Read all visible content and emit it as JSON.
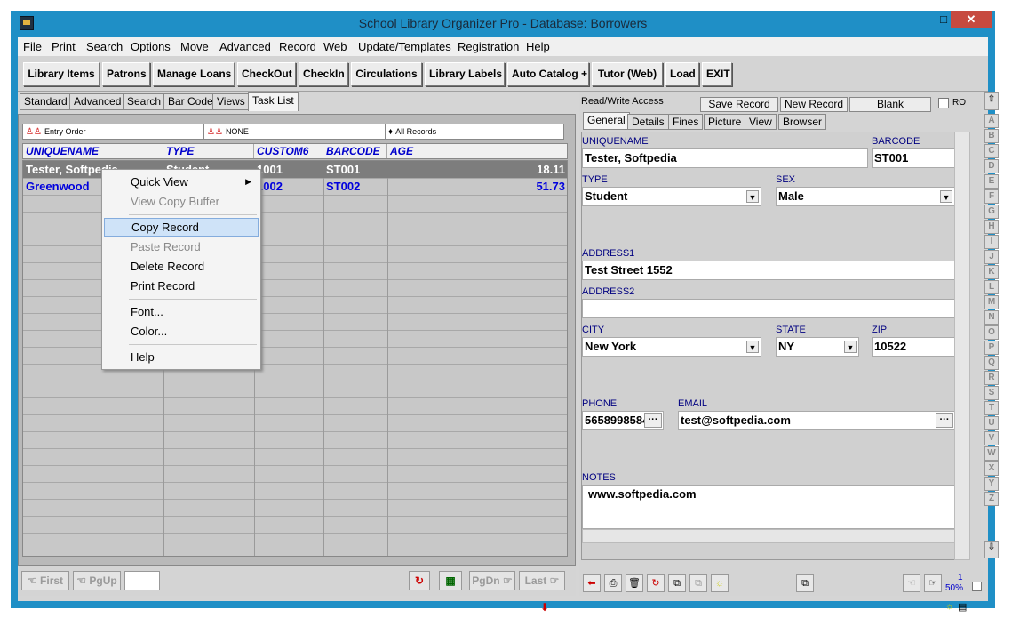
{
  "window": {
    "title": "School Library Organizer Pro - Database: Borrowers"
  },
  "menu": [
    "File",
    "Print",
    "Search",
    "Options",
    "Move",
    "Advanced",
    "Record",
    "Web",
    "Update/Templates",
    "Registration",
    "Help"
  ],
  "toolbar": [
    "Library Items",
    "Patrons",
    "Manage Loans",
    "CheckOut",
    "CheckIn",
    "Circulations",
    "Library Labels",
    "Auto Catalog +",
    "Tutor (Web)",
    "Load",
    "EXIT"
  ],
  "left_tabs": [
    "Standard",
    "Advanced",
    "Search",
    "Bar Code",
    "Views",
    "Task List"
  ],
  "sort_bar": [
    "Entry Order",
    "NONE",
    "All Records"
  ],
  "columns": [
    "UNIQUENAME",
    "TYPE",
    "CUSTOM6",
    "BARCODE",
    "AGE"
  ],
  "rows": [
    {
      "uniquename": "Tester, Softpedia",
      "type": "Student",
      "custom6": "1001",
      "barcode": "ST001",
      "age": "18.11"
    },
    {
      "uniquename": "Greenwood",
      "type": "",
      "custom6": "1002",
      "barcode": "ST002",
      "age": "51.73"
    }
  ],
  "context_menu": {
    "items": [
      {
        "label": "Quick View",
        "disabled": false,
        "submenu": true
      },
      {
        "label": "View Copy Buffer",
        "disabled": true
      },
      {
        "label": "Copy Record",
        "disabled": false,
        "highlighted": true
      },
      {
        "label": "Paste Record",
        "disabled": true
      },
      {
        "label": "Delete Record",
        "disabled": false
      },
      {
        "label": "Print Record",
        "disabled": false
      },
      {
        "label": "Font...",
        "disabled": false
      },
      {
        "label": "Color...",
        "disabled": false
      },
      {
        "label": "Help",
        "disabled": false
      }
    ]
  },
  "nav": {
    "first": "First",
    "pgup": "PgUp",
    "pgdn": "PgDn",
    "last": "Last"
  },
  "record_bar": {
    "access": "Read/Write Access",
    "save": "Save Record",
    "new": "New Record",
    "blank": "Blank",
    "ro": "RO"
  },
  "detail_tabs": [
    "General",
    "Details",
    "Fines",
    "Picture",
    "View",
    "Browser"
  ],
  "fields": {
    "uniquename": {
      "label": "UNIQUENAME",
      "value": "Tester, Softpedia"
    },
    "barcode": {
      "label": "BARCODE",
      "value": "ST001"
    },
    "type": {
      "label": "TYPE",
      "value": "Student"
    },
    "sex": {
      "label": "SEX",
      "value": "Male"
    },
    "address1": {
      "label": "ADDRESS1",
      "value": "Test Street 1552"
    },
    "address2": {
      "label": "ADDRESS2",
      "value": ""
    },
    "city": {
      "label": "CITY",
      "value": "New York"
    },
    "state": {
      "label": "STATE",
      "value": "NY"
    },
    "zip": {
      "label": "ZIP",
      "value": "10522"
    },
    "phone": {
      "label": "PHONE",
      "value": "5658998584"
    },
    "email": {
      "label": "EMAIL",
      "value": "test@softpedia.com"
    },
    "notes": {
      "label": "NOTES",
      "value": "www.softpedia.com"
    }
  },
  "alphabet": [
    "A",
    "B",
    "C",
    "D",
    "E",
    "F",
    "G",
    "H",
    "I",
    "J",
    "K",
    "L",
    "M",
    "N",
    "O",
    "P",
    "Q",
    "R",
    "S",
    "T",
    "U",
    "V",
    "W",
    "X",
    "Y",
    "Z"
  ],
  "zoom": "50%",
  "record_count": "1",
  "colors": {
    "titlebar": "#1f8fc6",
    "column_header": "#0000cc",
    "close": "#c74a3f"
  }
}
